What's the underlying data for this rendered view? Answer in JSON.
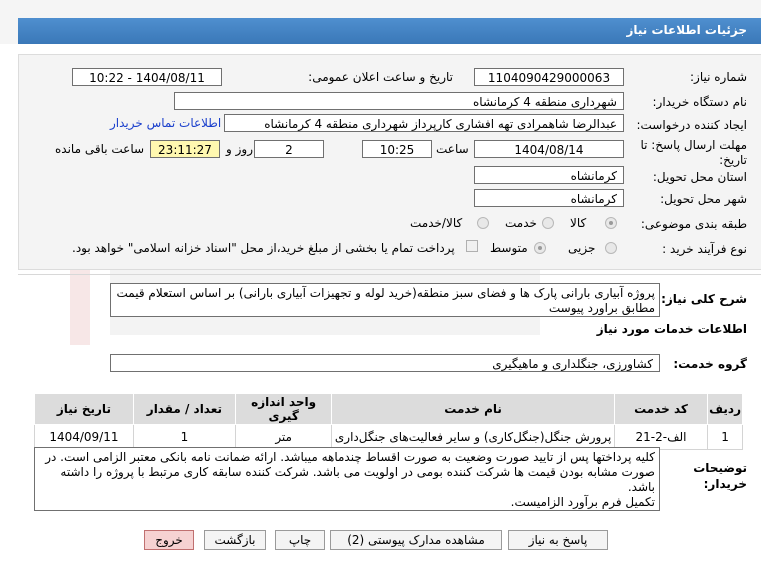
{
  "title": "جزئیات اطلاعات نیاز",
  "fields": {
    "need_number_label": "شماره نیاز:",
    "need_number": "1104090429000063",
    "announce_label": "تاریخ و ساعت اعلان عمومی:",
    "announce_value": "1404/08/11 - 10:22",
    "buyer_org_label": "نام دستگاه خریدار:",
    "buyer_org": "شهرداری منطقه 4 کرمانشاه",
    "creator_label": "ایجاد کننده درخواست:",
    "creator": "عبدالرضا شاهمرادی تهه افشاری کارپرداز شهرداری منطقه 4 کرمانشاه",
    "contact_link": "اطلاعات تماس خریدار",
    "deadline_label": "مهلت ارسال پاسخ: تا تاریخ:",
    "deadline_date": "1404/08/14",
    "time_label": "ساعت",
    "deadline_time": "10:25",
    "days": "2",
    "days_label": "روز و",
    "remaining": "23:11:27",
    "remaining_label": "ساعت باقی مانده",
    "province_label": "استان محل تحویل:",
    "province": "کرمانشاه",
    "city_label": "شهر محل تحویل:",
    "city": "کرمانشاه",
    "category_label": "طبقه بندی موضوعی:",
    "category_options": [
      "کالا",
      "خدمت",
      "کالا/خدمت"
    ],
    "purchase_type_label": "نوع فرآیند خرید :",
    "purchase_options": [
      "جزیی",
      "متوسط"
    ],
    "payment_note": "پرداخت تمام یا بخشی از مبلغ خرید،از محل \"اسناد خزانه اسلامی\" خواهد بود."
  },
  "summary": {
    "label": "شرح کلی نیاز:",
    "text": "پروژه آبیاری بارانی پارک ها و فضای سبز منطقه(خرید لوله و تجهیزات آبیاری بارانی) بر اساس استعلام قیمت مطابق براورد پیوست"
  },
  "services_heading": "اطلاعات خدمات مورد نیاز",
  "service_group_label": "گروه خدمت:",
  "service_group": "کشاورزی، جنگلداری و ماهیگیری",
  "table": {
    "headers": [
      "ردیف",
      "کد خدمت",
      "نام خدمت",
      "واحد اندازه گیری",
      "تعداد / مقدار",
      "تاریخ نیاز"
    ],
    "rows": [
      [
        "1",
        "الف-2-21",
        "پرورش جنگل(جنگل‌کاری) و سایر فعالیت‌های جنگل‌داری",
        "متر",
        "1",
        "1404/09/11"
      ]
    ]
  },
  "buyer_notes": {
    "label": "توضیحات خریدار:",
    "lines": [
      "کلیه پرداختها پس از تایید صورت وضعیت به صورت اقساط چندماهه میباشد. ارائه ضمانت نامه بانکی معتبر الزامی است. در",
      "صورت مشابه بودن قیمت ها شرکت کننده بومی در اولویت می باشد. شرکت کننده سابقه کاری مرتبط با پروژه را داشته",
      "باشد.",
      "تکمیل فرم برآورد الزامیست."
    ]
  },
  "buttons": {
    "reply": "پاسخ به نیاز",
    "attachments": "مشاهده مدارک پیوستی (2)",
    "print": "چاپ",
    "back": "بازگشت",
    "exit": "خروج"
  },
  "colors": {
    "header_blue": "#3f7fc0",
    "link_blue": "#1a3fcc",
    "exit_red": "#f6d2d2"
  }
}
